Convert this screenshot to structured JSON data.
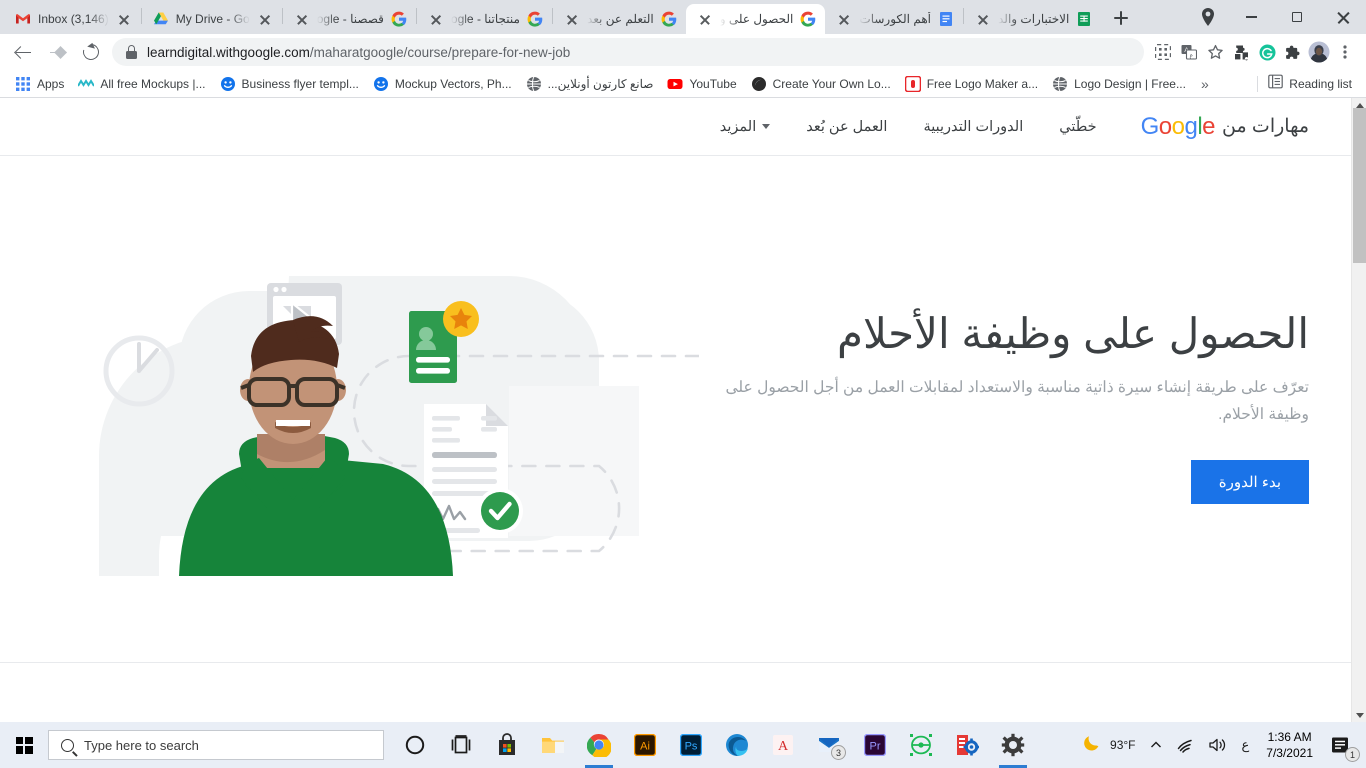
{
  "browser": {
    "tabs": [
      {
        "title": "Inbox (3,146)",
        "favicon": "gmail-icon",
        "active": false,
        "rtl": false
      },
      {
        "title": "My Drive - Go",
        "favicon": "drive-icon",
        "active": false,
        "rtl": false
      },
      {
        "title": "قصصنا - ogle",
        "favicon": "google-icon",
        "active": false,
        "rtl": true
      },
      {
        "title": "منتجاتنا - ogle",
        "favicon": "google-icon",
        "active": false,
        "rtl": true
      },
      {
        "title": "التعلم عن بعد",
        "favicon": "google-icon",
        "active": false,
        "rtl": true
      },
      {
        "title": "الحصول على و",
        "favicon": "google-icon",
        "active": true,
        "rtl": true
      },
      {
        "title": "أهم الكورسات",
        "favicon": "docs-icon",
        "active": false,
        "rtl": true
      },
      {
        "title": "الاختبارات والد",
        "favicon": "sheets-icon",
        "active": false,
        "rtl": true
      }
    ],
    "new_tab_label": "+",
    "window_controls": {
      "minimize": "minimize-icon",
      "maximize": "maximize-icon",
      "close": "close-icon"
    },
    "nav": {
      "back": "back-arrow-icon",
      "forward": "forward-arrow-icon",
      "reload": "reload-icon"
    },
    "omnibox": {
      "lock": "lock-icon",
      "url_domain": "learndigital.withgoogle.com",
      "url_path": "/maharatgoogle/course/prepare-for-new-job"
    },
    "toolbar_icons": [
      "qr-code-icon",
      "translate-icon",
      "star-icon",
      "extension-dark-icon",
      "grammarly-icon",
      "extensions-puzzle-icon",
      "profile-avatar",
      "three-dot-menu-icon"
    ],
    "bookmarks": [
      {
        "label": "Apps",
        "favicon": "apps-grid-icon"
      },
      {
        "label": "All free Mockups |...",
        "favicon": "mockups-icon"
      },
      {
        "label": "Business flyer templ...",
        "favicon": "freepik-icon"
      },
      {
        "label": "Mockup Vectors, Ph...",
        "favicon": "freepik-icon"
      },
      {
        "label": "صانع كارتون أونلاين...",
        "favicon": "globe-icon"
      },
      {
        "label": "YouTube",
        "favicon": "youtube-icon"
      },
      {
        "label": "Create Your Own Lo...",
        "favicon": "dark-circle-icon"
      },
      {
        "label": "Free Logo Maker a...",
        "favicon": "red-square-icon"
      },
      {
        "label": "Logo Design | Free...",
        "favicon": "globe-icon"
      }
    ],
    "bookmarks_overflow": "»",
    "reading_list": {
      "label": "Reading list",
      "icon": "reading-list-icon"
    },
    "scrollbar": {
      "up": "scroll-up-arrow",
      "down": "scroll-down-arrow"
    }
  },
  "page": {
    "header": {
      "brand_text": "مهارات من",
      "brand_logo": "Google",
      "nav_items": [
        {
          "label": "خطّتي"
        },
        {
          "label": "الدورات التدريبية"
        },
        {
          "label": "العمل عن بُعد"
        },
        {
          "label": "المزيد",
          "has_caret": true
        }
      ]
    },
    "hero": {
      "title": "الحصول على وظيفة الأحلام",
      "subtitle": "تعرّف على طريقة إنشاء سيرة ذاتية مناسبة والاستعداد لمقابلات العمل من أجل الحصول على وظيفة الأحلام.",
      "cta_label": "بدء الدورة",
      "illustration": "person-with-resume-illustration"
    },
    "colors": {
      "cta_blue": "#1a73e8",
      "heading_gray": "#3c4043",
      "subtext_gray": "#9aa0a6",
      "illustration_green": "#188038",
      "illustration_star_gold": "#F9AB00"
    }
  },
  "taskbar": {
    "start": "windows-start-icon",
    "search_placeholder": "Type here to search",
    "search_icon": "magnifier-icon",
    "buttons": [
      {
        "name": "cortana-icon"
      },
      {
        "name": "task-view-icon"
      },
      {
        "name": "microsoft-store-icon"
      },
      {
        "name": "file-explorer-icon"
      },
      {
        "name": "chrome-icon",
        "running": true
      },
      {
        "name": "illustrator-icon",
        "label": "Ai"
      },
      {
        "name": "photoshop-icon",
        "label": "Ps"
      },
      {
        "name": "edge-icon"
      },
      {
        "name": "autodesk-icon",
        "label": "A"
      },
      {
        "name": "mail-icon",
        "badge": "3"
      },
      {
        "name": "premiere-icon",
        "label": "Pr"
      },
      {
        "name": "shape-tool-icon"
      },
      {
        "name": "app-settings-icon"
      },
      {
        "name": "settings-gear-icon",
        "running": true
      }
    ],
    "tray": {
      "weather_icon": "moon-icon",
      "weather": "93°F",
      "chevron": "show-hidden-icons-chevron",
      "network_icon": "wifi-icon",
      "volume_icon": "speaker-icon",
      "language": "ع",
      "time": "1:36 AM",
      "date": "7/3/2021",
      "notifications_icon": "notifications-icon",
      "notifications_count": "1"
    }
  }
}
